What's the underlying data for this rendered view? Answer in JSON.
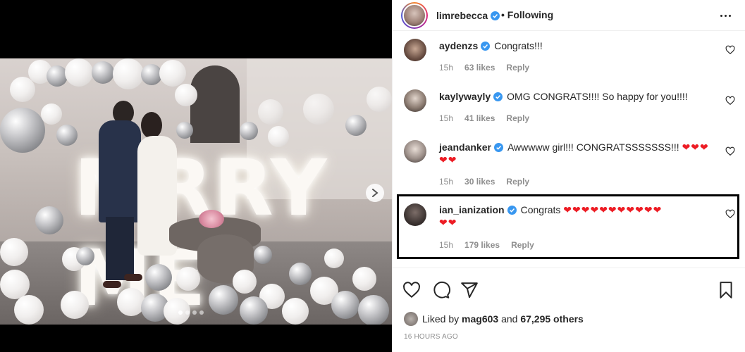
{
  "post": {
    "author": "limrebecca",
    "follow_status": "Following",
    "photo_sign_text": "MRRY ME",
    "carousel": {
      "pages": 4,
      "current": 1
    }
  },
  "comments": [
    {
      "user": "aydenzs",
      "text": "Congrats!!!",
      "hearts": "",
      "hearts2": "",
      "time": "15h",
      "likes": "63 likes",
      "reply": "Reply"
    },
    {
      "user": "kaylywayly",
      "text": "OMG CONGRATS!!!! So happy for you!!!!",
      "hearts": "",
      "hearts2": "",
      "time": "15h",
      "likes": "41 likes",
      "reply": "Reply"
    },
    {
      "user": "jeandanker",
      "text": "Awwwww girl!!! CONGRATSSSSSSS!!!",
      "hearts": "❤❤❤",
      "hearts2": "❤❤",
      "time": "15h",
      "likes": "30 likes",
      "reply": "Reply"
    },
    {
      "user": "ian_ianization",
      "text": "Congrats",
      "hearts": "❤❤❤❤❤❤❤❤❤❤❤",
      "hearts2": "❤❤",
      "time": "15h",
      "likes": "179 likes",
      "reply": "Reply"
    }
  ],
  "engagement": {
    "liked_prefix": "Liked by",
    "liked_user": "mag603",
    "liked_and": "and",
    "liked_others": "67,295 others",
    "timestamp": "16 HOURS AGO"
  },
  "colors": {
    "verified": "#3897f0",
    "heart": "#ed1c24",
    "meta": "#8e8e8e"
  },
  "icons": [
    "verified-badge-icon",
    "more-options-icon",
    "heart-outline-icon",
    "comment-icon",
    "share-icon",
    "bookmark-icon",
    "chevron-right-icon"
  ]
}
